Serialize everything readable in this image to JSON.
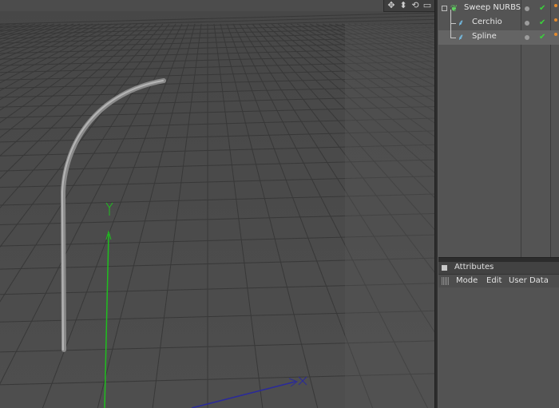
{
  "viewport": {
    "toolbar_icons": [
      "move-view-icon",
      "scroll-view-icon",
      "rotate-view-icon",
      "maximize-view-icon"
    ]
  },
  "object_manager": {
    "objects": [
      {
        "name": "Sweep NURBS",
        "icon": "sweep-nurbs-icon",
        "level": 0
      },
      {
        "name": "Cerchio",
        "icon": "spline-icon",
        "level": 1
      },
      {
        "name": "Spline",
        "icon": "spline-icon",
        "level": 1
      }
    ]
  },
  "attributes": {
    "title": "Attributes",
    "menu": [
      "Mode",
      "Edit",
      "User Data"
    ]
  },
  "colors": {
    "viewport_bg": "#4a4a4a",
    "grid": "#3a3a3a",
    "y_axis": "#1fbf1f",
    "x_axis": "#2a2a9a",
    "visible_check": "#3ad43a",
    "tag_orange": "#e08a30"
  }
}
